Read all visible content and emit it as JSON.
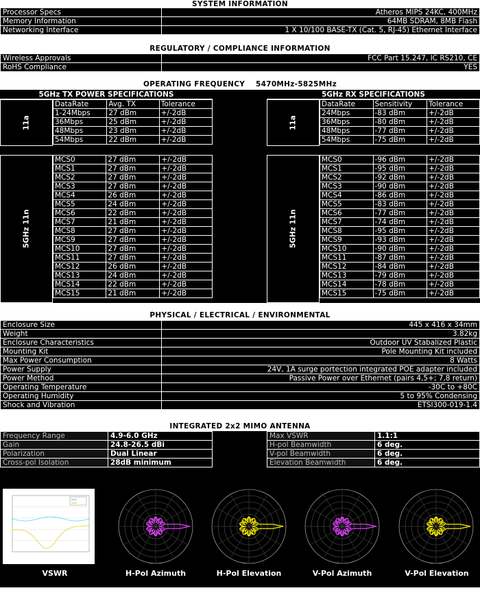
{
  "system": {
    "title": "SYSTEM INFORMATION",
    "rows": [
      {
        "k": "Processor Specs",
        "v": "Atheros  MIPS 24KC, 400MHz"
      },
      {
        "k": "Memory Information",
        "v": "64MB SDRAM, 8MB  Flash"
      },
      {
        "k": "Networking Interface",
        "v": "1 X 10/100 BASE-TX (Cat. 5, RJ-45) Ethernet Interface"
      }
    ]
  },
  "regulatory": {
    "title": "REGULATORY / COMPLIANCE INFORMATION",
    "rows": [
      {
        "k": "Wireless Approvals",
        "v": "FCC Part 15.247, IC RS210, CE"
      },
      {
        "k": "RoHS Compliance",
        "v": "YES"
      }
    ]
  },
  "freq": {
    "title": "OPERATING FREQUENCY",
    "range": "5470MHz-5825MHz",
    "tx_title": "5GHz TX POWER SPECIFICATIONS",
    "rx_title": "5GHz RX SPECIFICATIONS",
    "tx_head": [
      "DataRate",
      "Avg. TX",
      "Tolerance"
    ],
    "rx_head": [
      "DataRate",
      "Sensitivity",
      "Tolerance"
    ],
    "label_a": "11a",
    "label_n": "5GHz 11n",
    "tx_a": [
      [
        "1-24Mbps",
        "27 dBm",
        "+/-2dB"
      ],
      [
        "36Mbps",
        "25 dBm",
        "+/-2dB"
      ],
      [
        "48Mbps",
        "23 dBm",
        "+/-2dB"
      ],
      [
        "54Mbps",
        "22 dBm",
        "+/-2dB"
      ]
    ],
    "rx_a": [
      [
        "24Mbps",
        "-83 dBm",
        "+/-2dB"
      ],
      [
        "36Mbps",
        "-80 dBm",
        "+/-2dB"
      ],
      [
        "48Mbps",
        "-77 dBm",
        "+/-2dB"
      ],
      [
        "54Mbps",
        "-75 dBm",
        "+/-2dB"
      ]
    ],
    "tx_n": [
      [
        "MCS0",
        "27 dBm",
        "+/-2dB"
      ],
      [
        "MCS1",
        "27 dBm",
        "+/-2dB"
      ],
      [
        "MCS2",
        "27 dBm",
        "+/-2dB"
      ],
      [
        "MCS3",
        "27 dBm",
        "+/-2dB"
      ],
      [
        "MCS4",
        "26 dBm",
        "+/-2dB"
      ],
      [
        "MCS5",
        "24 dBm",
        "+/-2dB"
      ],
      [
        "MCS6",
        "22 dBm",
        "+/-2dB"
      ],
      [
        "MCS7",
        "21 dBm",
        "+/-2dB"
      ],
      [
        "MCS8",
        "27 dBm",
        "+/-2dB"
      ],
      [
        "MCS9",
        "27 dBm",
        "+/-2dB"
      ],
      [
        "MCS10",
        "27 dBm",
        "+/-2dB"
      ],
      [
        "MCS11",
        "27 dBm",
        "+/-2dB"
      ],
      [
        "MCS12",
        "26 dBm",
        "+/-2dB"
      ],
      [
        "MCS13",
        "24 dBm",
        "+/-2dB"
      ],
      [
        "MCS14",
        "22 dBm",
        "+/-2dB"
      ],
      [
        "MCS15",
        "21 dBm",
        "+/-2dB"
      ]
    ],
    "rx_n": [
      [
        "MCS0",
        "-96 dBm",
        "+/-2dB"
      ],
      [
        "MCS1",
        "-95 dBm",
        "+/-2dB"
      ],
      [
        "MCS2",
        "-92 dBm",
        "+/-2dB"
      ],
      [
        "MCS3",
        "-90 dBm",
        "+/-2dB"
      ],
      [
        "MCS4",
        "-86 dBm",
        "+/-2dB"
      ],
      [
        "MCS5",
        "-83 dBm",
        "+/-2dB"
      ],
      [
        "MCS6",
        "-77 dBm",
        "+/-2dB"
      ],
      [
        "MCS7",
        "-74 dBm",
        "+/-2dB"
      ],
      [
        "MCS8",
        "-95 dBm",
        "+/-2dB"
      ],
      [
        "MCS9",
        "-93 dBm",
        "+/-2dB"
      ],
      [
        "MCS10",
        "-90 dBm",
        "+/-2dB"
      ],
      [
        "MCS11",
        "-87 dBm",
        "+/-2dB"
      ],
      [
        "MCS12",
        "-84 dBm",
        "+/-2dB"
      ],
      [
        "MCS13",
        "-79 dBm",
        "+/-2dB"
      ],
      [
        "MCS14",
        "-78 dBm",
        "+/-2dB"
      ],
      [
        "MCS15",
        "-75 dBm",
        "+/-2dB"
      ]
    ]
  },
  "physical": {
    "title": "PHYSICAL / ELECTRICAL / ENVIRONMENTAL",
    "rows": [
      {
        "k": "Enclosure Size",
        "v": "445 x 416 x 34mm"
      },
      {
        "k": "Weight",
        "v": "3.82kg"
      },
      {
        "k": "Enclosure Characteristics",
        "v": "Outdoor UV Stabalized Plastic"
      },
      {
        "k": "Mounting Kit",
        "v": "Pole Mounting Kit included"
      },
      {
        "k": "Max Power Consumption",
        "v": "8 Watts"
      },
      {
        "k": "Power Supply",
        "v": "24V, 1A surge portection integrated POE adapter  included"
      },
      {
        "k": "Power Method",
        "v": "Passive Power over Ethernet (pairs 4,5+; 7,8 return)"
      },
      {
        "k": "Operating Temperature",
        "v": "-30C to +80C"
      },
      {
        "k": "Operating Humidity",
        "v": "5 to 95% Condensing"
      },
      {
        "k": "Shock and Vibration",
        "v": "ETSI300-019-1.4"
      }
    ]
  },
  "antenna": {
    "title": "INTEGRATED 2x2 MIMO ANTENNA",
    "left": [
      {
        "k": "Frequency Range",
        "v": "4.9-6.0 GHz"
      },
      {
        "k": "Gain",
        "v": "24.8-26.5 dBi"
      },
      {
        "k": "Polarization",
        "v": "Dual Linear"
      },
      {
        "k": "Cross-pol Isolation",
        "v": "28dB minimum"
      }
    ],
    "right": [
      {
        "k": "Max VSWR",
        "v": "1.1:1"
      },
      {
        "k": "H-pol Beamwidth",
        "v": "6 deg."
      },
      {
        "k": "V-pol Beamwidth",
        "v": "6 deg."
      },
      {
        "k": "Elevation Beamwidth",
        "v": "6 deg."
      }
    ],
    "captions": [
      "VSWR",
      "H-Pol Azimuth",
      "H-Pol Elevation",
      "V-Pol Azimuth",
      "V-Pol Elevation"
    ],
    "colors": {
      "magenta": "#e040fb",
      "yellow": "#ffee00",
      "cyan": "#33ccff"
    }
  }
}
